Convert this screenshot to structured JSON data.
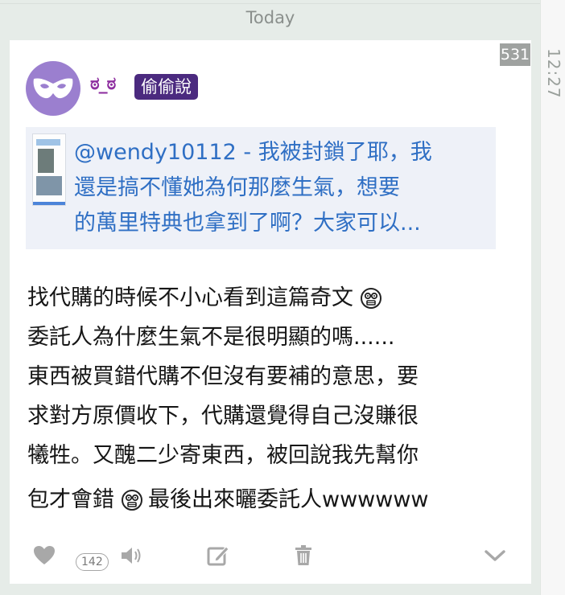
{
  "date_header": "Today",
  "time": "12:27",
  "post": {
    "count_badge": "531",
    "username": "ಠ_ಠ",
    "tag": "偷偷說",
    "link_preview": {
      "lines": [
        "@wendy10112 - 我被封鎖了耶，我",
        "還是搞不懂她為何那麼生氣，想要",
        "的萬里特典也拿到了啊？大家可以..."
      ]
    },
    "body": {
      "line1": "找代購的時候不小心看到這篇奇文",
      "line2": "委託人為什麼生氣不是很明顯的嗎......",
      "line3": "東西被買錯代購不但沒有要補的意思，要",
      "line4": "求對方原價收下，代購還覺得自己沒賺很",
      "line5": "犧牲。又醜二少寄東西，被回說我先幫你",
      "line6a": "包才會錯",
      "line6b": "最後出來曬委託人wwwwww"
    },
    "actions": {
      "like_count": "142"
    }
  },
  "icons": {
    "avatar": "mask-icon",
    "like": "heart-icon",
    "speak": "speaker-icon",
    "edit": "edit-icon",
    "delete": "trash-icon",
    "more": "chevron-down-icon",
    "emoji": "shocked-face-icon"
  }
}
